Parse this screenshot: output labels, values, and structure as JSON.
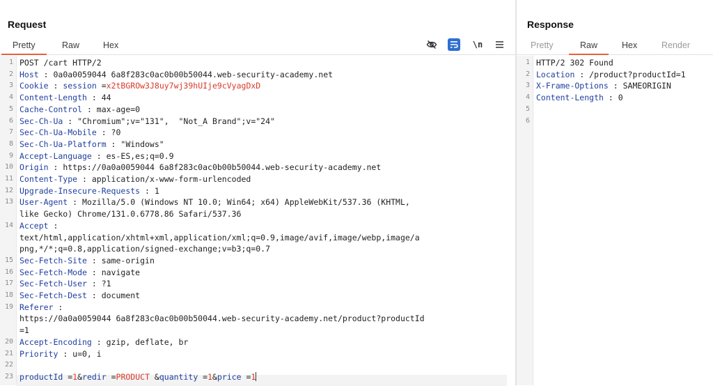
{
  "request": {
    "title": "Request",
    "tabs": [
      "Pretty",
      "Raw",
      "Hex"
    ],
    "tools": [
      "\\n"
    ],
    "lines": [
      {
        "n": "1",
        "parts": [
          [
            "v",
            "POST /cart HTTP/2"
          ]
        ]
      },
      {
        "n": "2",
        "parts": [
          [
            "k",
            "Host"
          ],
          [
            "v",
            " : 0a0a0059044 6a8f283c0ac0b00b50044.web-security-academy.net"
          ]
        ]
      },
      {
        "n": "3",
        "parts": [
          [
            "k",
            "Cookie"
          ],
          [
            "v",
            " : "
          ],
          [
            "k",
            "session"
          ],
          [
            "v",
            " ="
          ],
          [
            "r",
            "x2tBGROw3J8uy7wj39hUIje9cVyagDxD"
          ]
        ]
      },
      {
        "n": "4",
        "parts": [
          [
            "k",
            "Content-Length"
          ],
          [
            "v",
            " : 44"
          ]
        ]
      },
      {
        "n": "5",
        "parts": [
          [
            "k",
            "Cache-Control"
          ],
          [
            "v",
            " : max-age=0"
          ]
        ]
      },
      {
        "n": "6",
        "parts": [
          [
            "k",
            "Sec-Ch-Ua"
          ],
          [
            "v",
            " : \"Chromium\";v=\"131\",  \"Not_A Brand\";v=\"24\""
          ]
        ]
      },
      {
        "n": "7",
        "parts": [
          [
            "k",
            "Sec-Ch-Ua-Mobile"
          ],
          [
            "v",
            " : ?0"
          ]
        ]
      },
      {
        "n": "8",
        "parts": [
          [
            "k",
            "Sec-Ch-Ua-Platform"
          ],
          [
            "v",
            " : \"Windows\""
          ]
        ]
      },
      {
        "n": "9",
        "parts": [
          [
            "k",
            "Accept-Language"
          ],
          [
            "v",
            " : es-ES,es;q=0.9"
          ]
        ]
      },
      {
        "n": "10",
        "parts": [
          [
            "k",
            "Origin"
          ],
          [
            "v",
            " : https://0a0a0059044 6a8f283c0ac0b00b50044.web-security-academy.net"
          ]
        ]
      },
      {
        "n": "11",
        "parts": [
          [
            "k",
            "Content-Type"
          ],
          [
            "v",
            " : application/x-www-form-urlencoded"
          ]
        ]
      },
      {
        "n": "12",
        "parts": [
          [
            "k",
            "Upgrade-Insecure-Requests"
          ],
          [
            "v",
            " : 1"
          ]
        ]
      },
      {
        "n": "13",
        "parts": [
          [
            "k",
            "User-Agent"
          ],
          [
            "v",
            " : Mozilla/5.0 (Windows NT 10.0; Win64; x64) AppleWebKit/537.36 (KHTML,"
          ]
        ]
      },
      {
        "n": "",
        "parts": [
          [
            "v",
            "like Gecko) Chrome/131.0.6778.86 Safari/537.36"
          ]
        ]
      },
      {
        "n": "14",
        "parts": [
          [
            "k",
            "Accept"
          ],
          [
            "v",
            " :"
          ]
        ]
      },
      {
        "n": "",
        "parts": [
          [
            "v",
            "text/html,application/xhtml+xml,application/xml;q=0.9,image/avif,image/webp,image/a"
          ]
        ]
      },
      {
        "n": "",
        "parts": [
          [
            "v",
            "png,*/*;q=0.8,application/signed-exchange;v=b3;q=0.7"
          ]
        ]
      },
      {
        "n": "15",
        "parts": [
          [
            "k",
            "Sec-Fetch-Site"
          ],
          [
            "v",
            " : same-origin"
          ]
        ]
      },
      {
        "n": "16",
        "parts": [
          [
            "k",
            "Sec-Fetch-Mode"
          ],
          [
            "v",
            " : navigate"
          ]
        ]
      },
      {
        "n": "17",
        "parts": [
          [
            "k",
            "Sec-Fetch-User"
          ],
          [
            "v",
            " : ?1"
          ]
        ]
      },
      {
        "n": "18",
        "parts": [
          [
            "k",
            "Sec-Fetch-Dest"
          ],
          [
            "v",
            " : document"
          ]
        ]
      },
      {
        "n": "19",
        "parts": [
          [
            "k",
            "Referer"
          ],
          [
            "v",
            " :"
          ]
        ]
      },
      {
        "n": "",
        "parts": [
          [
            "v",
            "https://0a0a0059044 6a8f283c0ac0b00b50044.web-security-academy.net/product?productId"
          ]
        ]
      },
      {
        "n": "",
        "parts": [
          [
            "v",
            "=1"
          ]
        ]
      },
      {
        "n": "20",
        "parts": [
          [
            "k",
            "Accept-Encoding"
          ],
          [
            "v",
            " : gzip, deflate, br"
          ]
        ]
      },
      {
        "n": "21",
        "parts": [
          [
            "k",
            "Priority"
          ],
          [
            "v",
            " : u=0, i"
          ]
        ]
      },
      {
        "n": "22",
        "parts": []
      },
      {
        "n": "23",
        "parts": [
          [
            "k",
            "productId"
          ],
          [
            "v",
            " ="
          ],
          [
            "r",
            "1"
          ],
          [
            "v",
            "&"
          ],
          [
            "k",
            "redir"
          ],
          [
            "v",
            " ="
          ],
          [
            "r",
            "PRODUCT"
          ],
          [
            "v",
            " &"
          ],
          [
            "k",
            "quantity"
          ],
          [
            "v",
            " ="
          ],
          [
            "r",
            "1"
          ],
          [
            "v",
            "&"
          ],
          [
            "k",
            "price"
          ],
          [
            "v",
            " ="
          ],
          [
            "r",
            "1"
          ]
        ]
      }
    ]
  },
  "response": {
    "title": "Response",
    "tabs": [
      "Pretty",
      "Raw",
      "Hex",
      "Render"
    ],
    "lines": [
      {
        "n": "1",
        "parts": [
          [
            "v",
            "HTTP/2 302 Found"
          ]
        ]
      },
      {
        "n": "2",
        "parts": [
          [
            "k",
            "Location"
          ],
          [
            "v",
            " : /product?productId=1"
          ]
        ]
      },
      {
        "n": "3",
        "parts": [
          [
            "k",
            "X-Frame-Options"
          ],
          [
            "v",
            " : SAMEORIGIN"
          ]
        ]
      },
      {
        "n": "4",
        "parts": [
          [
            "k",
            "Content-Length"
          ],
          [
            "v",
            " : 0"
          ]
        ]
      },
      {
        "n": "5",
        "parts": []
      },
      {
        "n": "6",
        "parts": []
      }
    ]
  },
  "icons": {
    "hide": "eye-off-icon",
    "wrap": "word-wrap-icon",
    "newline": "newline-icon",
    "menu": "hamburger-menu-icon"
  },
  "colors": {
    "accent": "#e8603a",
    "key": "#1f3f9f",
    "value_red": "#d83a2a",
    "tool_active": "#2f6fd1"
  }
}
